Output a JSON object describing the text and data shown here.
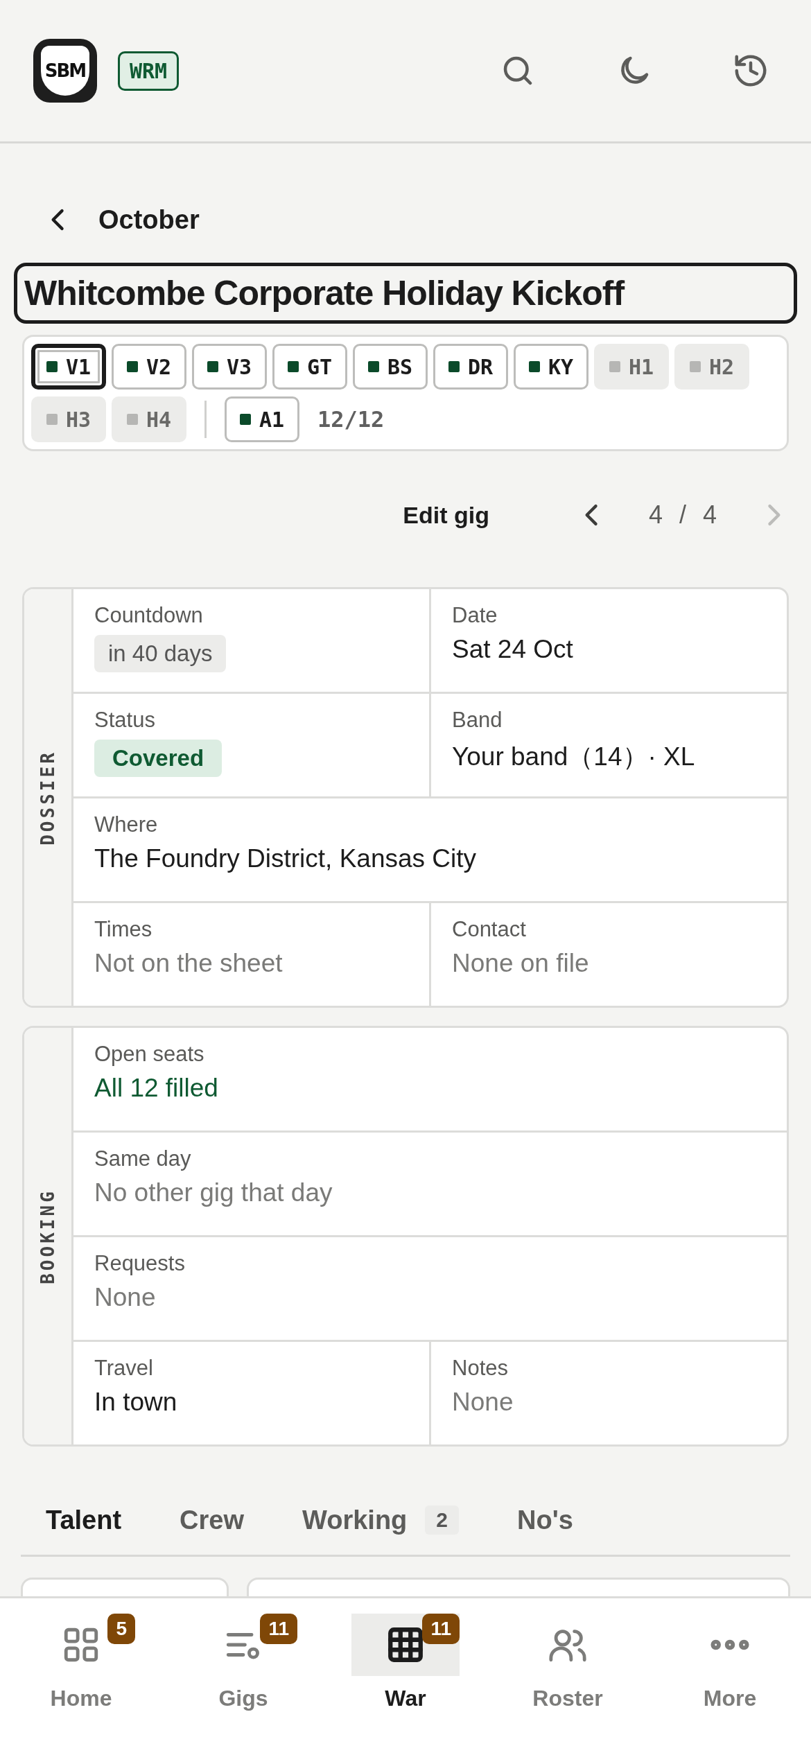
{
  "header": {
    "logo": "SBM",
    "badge": "WRM"
  },
  "back": {
    "label": "October"
  },
  "title": "Whitcombe Corporate Holiday Kickoff",
  "roster": {
    "primary": [
      {
        "label": "V1",
        "filled": true,
        "selected": true
      },
      {
        "label": "V2",
        "filled": true,
        "selected": false
      },
      {
        "label": "V3",
        "filled": true,
        "selected": false
      },
      {
        "label": "GT",
        "filled": true,
        "selected": false
      },
      {
        "label": "BS",
        "filled": true,
        "selected": false
      },
      {
        "label": "DR",
        "filled": true,
        "selected": false
      },
      {
        "label": "KY",
        "filled": true,
        "selected": false
      },
      {
        "label": "H1",
        "filled": false,
        "selected": false
      },
      {
        "label": "H2",
        "filled": false,
        "selected": false
      },
      {
        "label": "H3",
        "filled": false,
        "selected": false
      },
      {
        "label": "H4",
        "filled": false,
        "selected": false
      }
    ],
    "alternates": [
      {
        "label": "A1",
        "filled": true,
        "selected": false
      }
    ],
    "count": "12/12"
  },
  "actions": {
    "edit": "Edit gig",
    "pager": "4 / 4",
    "prev_disabled": false,
    "next_disabled": true
  },
  "sections": [
    {
      "label": "DOSSIER",
      "rows": [
        [
          {
            "label": "Countdown",
            "value": "in 40 days",
            "kind": "pill"
          },
          {
            "label": "Date",
            "value": "Sat 24 Oct",
            "kind": "strong"
          }
        ],
        [
          {
            "label": "Status",
            "value": "Covered",
            "kind": "status"
          },
          {
            "label": "Band",
            "value": "Your band（14）· XL",
            "kind": "strong"
          }
        ],
        [
          {
            "label": "Where",
            "value": "The Foundry District, Kansas City",
            "kind": "strong"
          }
        ],
        [
          {
            "label": "Times",
            "value": "Not on the sheet",
            "kind": "muted"
          },
          {
            "label": "Contact",
            "value": "None on file",
            "kind": "muted"
          }
        ]
      ]
    },
    {
      "label": "BOOKING",
      "rows": [
        [
          {
            "label": "Open seats",
            "value": "All 12 filled",
            "kind": "positive"
          }
        ],
        [
          {
            "label": "Same day",
            "value": "No other gig that day",
            "kind": "muted"
          }
        ],
        [
          {
            "label": "Requests",
            "value": "None",
            "kind": "muted"
          }
        ],
        [
          {
            "label": "Travel",
            "value": "In town",
            "kind": "strong"
          },
          {
            "label": "Notes",
            "value": "None",
            "kind": "muted"
          }
        ]
      ]
    }
  ],
  "tabs": [
    {
      "label": "Talent",
      "selected": true
    },
    {
      "label": "Crew",
      "selected": false
    },
    {
      "label": "Working",
      "count": "2",
      "selected": false
    },
    {
      "label": "No's",
      "selected": false
    }
  ],
  "nav": [
    {
      "label": "Home",
      "kind": "grid",
      "badge": "5",
      "selected": false
    },
    {
      "label": "Gigs",
      "kind": "list",
      "badge": "11",
      "selected": false
    },
    {
      "label": "War",
      "kind": "table",
      "badge": "11",
      "selected": true
    },
    {
      "label": "Roster",
      "kind": "people",
      "selected": false
    },
    {
      "label": "More",
      "kind": "dots",
      "selected": false
    }
  ]
}
